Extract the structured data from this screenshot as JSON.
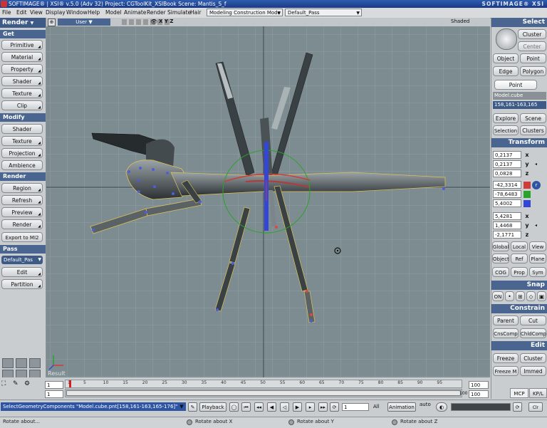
{
  "titlebar": {
    "title": "SOFTIMAGE® | XSI® v.5.0 (Adv 32) Project: CGToolKit_XSIBook   Scene: Mantis_S_f",
    "brand": "SOFTIMAGE® XSI"
  },
  "menubar": {
    "items": [
      "File",
      "Edit",
      "View",
      "Display",
      "Window",
      "Help",
      "Model",
      "Animate",
      "Render",
      "Simulate",
      "Hair"
    ],
    "mode_dropdown": "Modeling Construction Mode",
    "pass_dropdown": "Default_Pass"
  },
  "left_panel": {
    "title": "Render",
    "sections": {
      "get": "Get",
      "modify": "Modify",
      "render": "Render",
      "pass": "Pass"
    },
    "get_buttons": [
      "Primitive",
      "Material",
      "Property",
      "Shader",
      "Texture",
      "Clip"
    ],
    "modify_buttons": [
      "Shader",
      "Texture",
      "Projection",
      "Ambience"
    ],
    "render_buttons": [
      "Region",
      "Refresh",
      "Preview",
      "Render",
      "Export to MI2"
    ],
    "pass_field": "Default_Pas",
    "pass_buttons": [
      "Edit",
      "Partition"
    ]
  },
  "viewport": {
    "camera_label": "User",
    "axes_label": "X Y Z",
    "shading_label": "Shaded",
    "result_label": "Result"
  },
  "right_panel": {
    "select": {
      "title": "Select",
      "cluster": "Cluster",
      "center": "Center",
      "object": "Object",
      "point_btn": "Point",
      "edge": "Edge",
      "polygon": "Polygon",
      "point_mode": "Point",
      "selection_name": "Model.cube",
      "selection_range": "158,161-163,165",
      "explore": "Explore",
      "scene": "Scene",
      "selection": "Selection",
      "clusters": "Clusters"
    },
    "transform": {
      "title": "Transform",
      "scale": [
        "0,2137",
        "0,2137",
        "0,0828"
      ],
      "rotation": [
        "-42,3314",
        "-78,6483",
        "5,4002"
      ],
      "translation": [
        "5,4281",
        "1,4468",
        "-2,1771"
      ],
      "axes": [
        "x",
        "y",
        "z"
      ],
      "buttons": [
        "Global",
        "Local",
        "View",
        "Object",
        "Ref",
        "Plane",
        "COG",
        "Prop",
        "Sym"
      ]
    },
    "snap": {
      "title": "Snap",
      "on": "ON"
    },
    "constrain": {
      "title": "Constrain",
      "parent": "Parent",
      "cut": "Cut",
      "cnscomp": "CnsComp",
      "chldcomp": "ChldComp"
    },
    "edit": {
      "title": "Edit",
      "freeze": "Freeze",
      "cluster": "Cluster",
      "freeze_m": "Freeze M",
      "immed": "Immed"
    },
    "mcp": "MCP",
    "kpl": "KP/L"
  },
  "timeline": {
    "start": "1",
    "start2": "1",
    "end": "100",
    "end2": "100",
    "current": "100",
    "ticks": [
      "1",
      "5",
      "10",
      "15",
      "20",
      "25",
      "30",
      "35",
      "40",
      "45",
      "50",
      "55",
      "60",
      "65",
      "70",
      "75",
      "80",
      "85",
      "90",
      "95"
    ]
  },
  "command_bar": {
    "command": "SelectGeometryComponents \"Model.cube.pnt[158,161-163,165-176]\"",
    "playback": "Playback",
    "frame": "1",
    "all": "All",
    "animation": "Animation",
    "auto": "auto"
  },
  "status_bar": {
    "left": "Rotate about...",
    "x": "Rotate about X",
    "y": "Rotate about Y",
    "z": "Rotate about Z"
  }
}
